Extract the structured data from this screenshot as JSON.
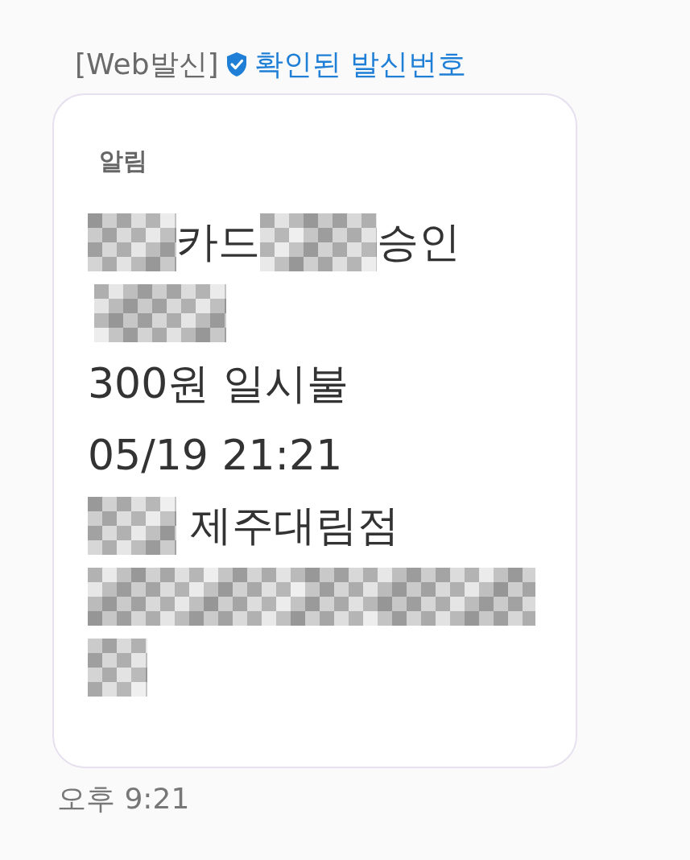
{
  "header": {
    "sender_tag": "[Web발신]",
    "verified": true,
    "verified_label": "확인된 발신번호"
  },
  "message": {
    "title": "알림",
    "lines": [
      [
        {
          "kind": "redacted"
        },
        {
          "kind": "text",
          "text": "카드"
        },
        {
          "kind": "redacted"
        },
        {
          "kind": "text",
          "text": "승인"
        }
      ],
      [
        {
          "kind": "redacted"
        }
      ],
      [
        {
          "kind": "text",
          "text": "300원 일시불"
        }
      ],
      [
        {
          "kind": "text",
          "text": "05/19 21:21"
        }
      ],
      [
        {
          "kind": "redacted"
        },
        {
          "kind": "text",
          "text": " 제주대림점"
        }
      ],
      [
        {
          "kind": "redacted"
        }
      ],
      [
        {
          "kind": "redacted"
        }
      ]
    ]
  },
  "time": "오후 9:21"
}
